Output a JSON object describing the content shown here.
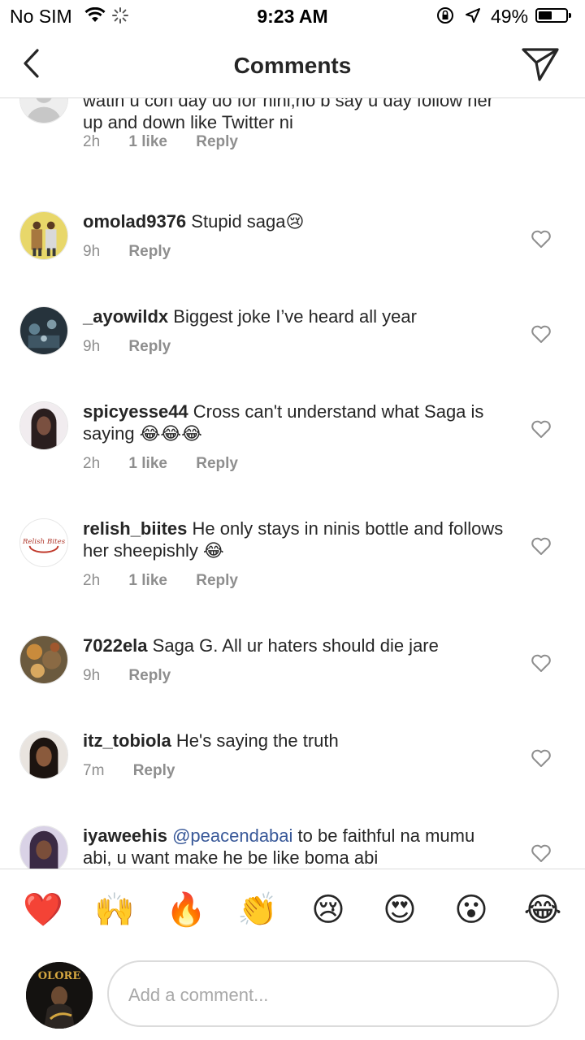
{
  "status_bar": {
    "carrier": "No SIM",
    "time": "9:23 AM",
    "battery": "49%",
    "battery_level": 0.49
  },
  "header": {
    "title": "Comments",
    "back_icon": "chevron-left-icon",
    "send_icon": "paper-plane-icon"
  },
  "comments": [
    {
      "user": "",
      "text": "watin u con day do for nini,no b say u day follow her up and down like Twitter ni",
      "time": "2h",
      "likes": "1 like",
      "reply": "Reply"
    },
    {
      "user": "omolad9376",
      "text": "Stupid saga😢",
      "time": "9h",
      "likes": "",
      "reply": "Reply"
    },
    {
      "user": "_ayowildx",
      "text": "Biggest joke I’ve heard all year",
      "time": "9h",
      "likes": "",
      "reply": "Reply"
    },
    {
      "user": "spicyesse44",
      "text": "Cross can't understand what Saga is saying 😂😂😂",
      "time": "2h",
      "likes": "1 like",
      "reply": "Reply"
    },
    {
      "user": "relish_biites",
      "text": "He only stays in ninis bottle and follows her sheepishly 😂",
      "time": "2h",
      "likes": "1 like",
      "reply": "Reply"
    },
    {
      "user": "7022ela",
      "text": "Saga G. All ur haters should die jare",
      "time": "9h",
      "likes": "",
      "reply": "Reply"
    },
    {
      "user": "itz_tobiola",
      "text": "He's saying the truth",
      "time": "7m",
      "likes": "",
      "reply": "Reply"
    },
    {
      "user": "iyaweehis",
      "mention": "@peacendabai",
      "text": "to be faithful na mumu abi, u want make he be like boma abi",
      "time": "",
      "likes": "",
      "reply": ""
    }
  ],
  "avatar_logo_text": "Relish Bites",
  "emojis": [
    "❤️",
    "🙌",
    "🔥",
    "👏",
    "😢",
    "😍",
    "😮",
    "😂"
  ],
  "composer": {
    "placeholder": "Add a comment...",
    "avatar_text": "OLORE"
  },
  "colors": {
    "meta_gray": "#8e8e8e",
    "mention_blue": "#385898",
    "divider": "#dbdbdb"
  }
}
